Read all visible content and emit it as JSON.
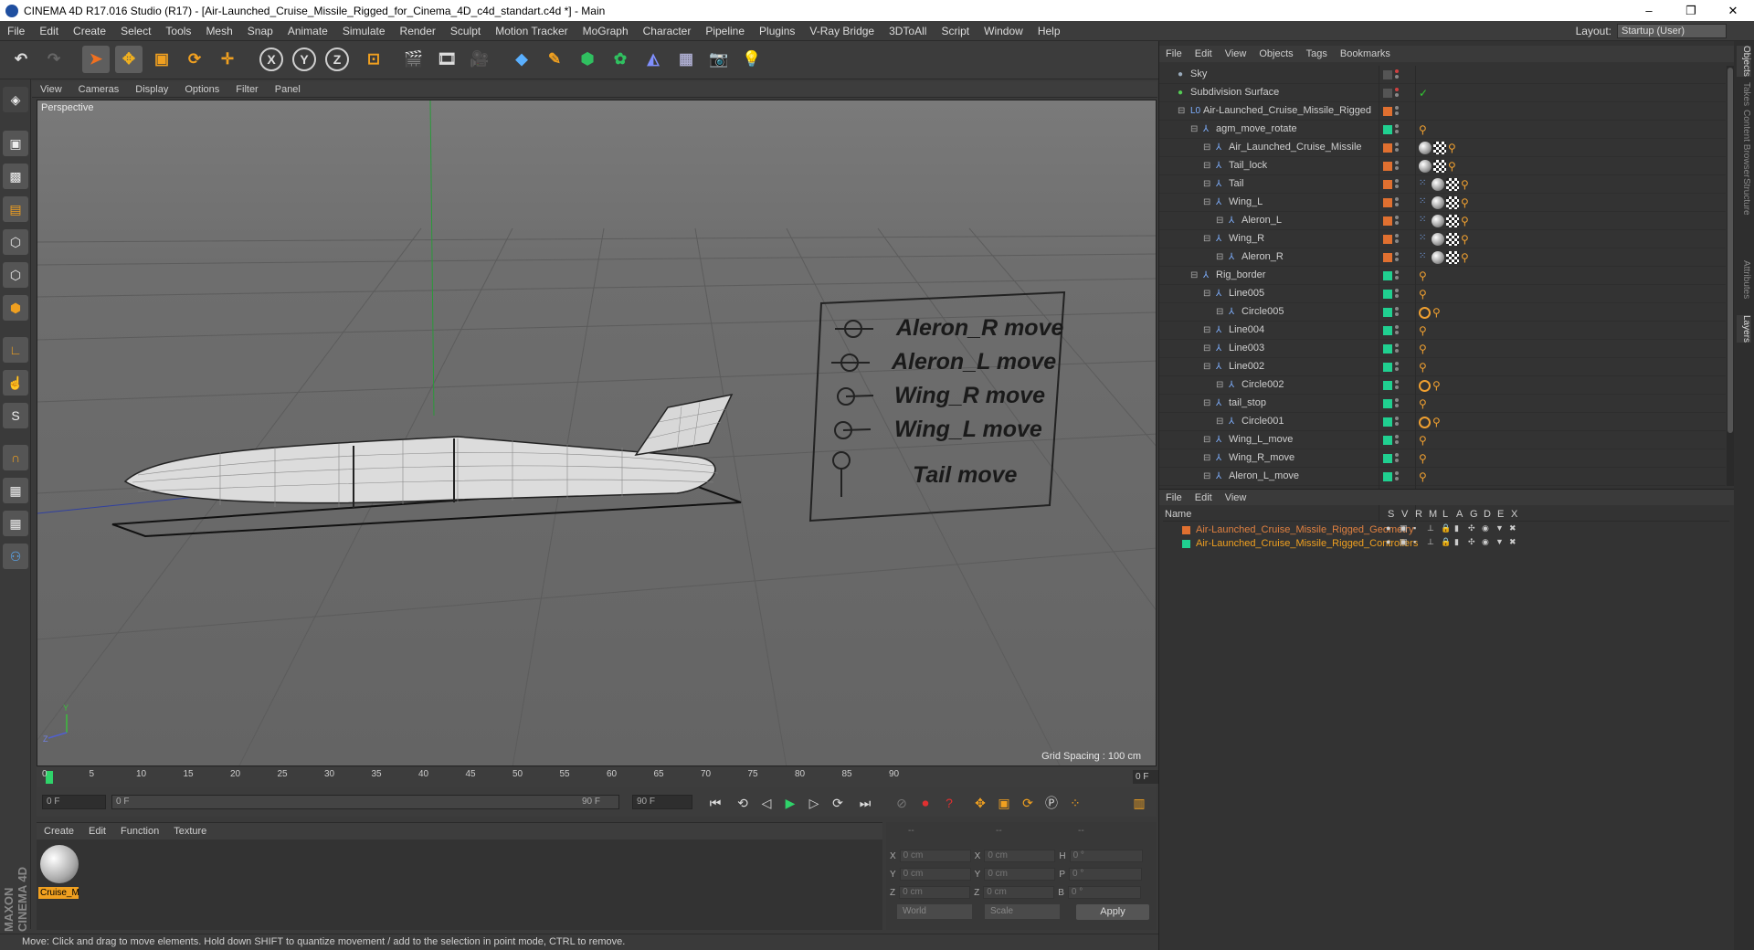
{
  "window": {
    "title": "CINEMA 4D R17.016 Studio (R17) - [Air-Launched_Cruise_Missile_Rigged_for_Cinema_4D_c4d_standart.c4d *] - Main",
    "minimize": "–",
    "maximize": "❐",
    "close": "✕"
  },
  "menu": [
    "File",
    "Edit",
    "Create",
    "Select",
    "Tools",
    "Mesh",
    "Snap",
    "Animate",
    "Simulate",
    "Render",
    "Sculpt",
    "Motion Tracker",
    "MoGraph",
    "Character",
    "Pipeline",
    "Plugins",
    "V-Ray Bridge",
    "3DToAll",
    "Script",
    "Window",
    "Help"
  ],
  "layout": {
    "label": "Layout:",
    "value": "Startup (User)"
  },
  "toolbar": {
    "x": "X",
    "y": "Y",
    "z": "Z"
  },
  "viewport": {
    "menu": [
      "View",
      "Cameras",
      "Display",
      "Options",
      "Filter",
      "Panel"
    ],
    "label": "Perspective",
    "grid_spacing": "Grid Spacing : 100 cm",
    "controls": [
      "Aleron_R move",
      "Aleron_L move",
      "Wing_R move",
      "Wing_L move",
      "Tail move"
    ],
    "axis_y": "Y",
    "axis_z": "Z"
  },
  "timeline": {
    "ticks": [
      "0",
      "5",
      "10",
      "15",
      "20",
      "25",
      "30",
      "35",
      "40",
      "45",
      "50",
      "55",
      "60",
      "65",
      "70",
      "75",
      "80",
      "85",
      "90"
    ],
    "current_frame": "0 F",
    "start": "0 F",
    "slider_start": "0 F",
    "slider_end": "90 F",
    "end": "90 F"
  },
  "material_panel": {
    "menu": [
      "Create",
      "Edit",
      "Function",
      "Texture"
    ],
    "material_name": "Cruise_M"
  },
  "coords": {
    "headers": [
      "--",
      "--",
      "--"
    ],
    "rows": [
      {
        "a": "X",
        "av": "0 cm",
        "b": "X",
        "bv": "0 cm",
        "c": "H",
        "cv": "0 °"
      },
      {
        "a": "Y",
        "av": "0 cm",
        "b": "Y",
        "bv": "0 cm",
        "c": "P",
        "cv": "0 °"
      },
      {
        "a": "Z",
        "av": "0 cm",
        "b": "Z",
        "bv": "0 cm",
        "c": "B",
        "cv": "0 °"
      }
    ],
    "world": "World",
    "scale": "Scale",
    "apply": "Apply"
  },
  "status": "Move: Click and drag to move elements. Hold down SHIFT to quantize movement / add to the selection in point mode, CTRL to remove.",
  "maxon": "MAXON CINEMA 4D",
  "objects_panel": {
    "menu": [
      "File",
      "Edit",
      "View",
      "Objects",
      "Tags",
      "Bookmarks"
    ],
    "items": [
      {
        "name": "Sky",
        "indent": 0,
        "layer": "",
        "tags": []
      },
      {
        "name": "Subdivision Surface",
        "indent": 0,
        "layer": "",
        "tags": []
      },
      {
        "name": "Air-Launched_Cruise_Missile_Rigged",
        "indent": 1,
        "layer": "#e07030",
        "tags": []
      },
      {
        "name": "agm_move_rotate",
        "indent": 2,
        "layer": "#20d090",
        "tags": [
          "bone"
        ]
      },
      {
        "name": "Air_Launched_Cruise_Missile",
        "indent": 3,
        "layer": "#e07030",
        "tags": [
          "sph",
          "chk",
          "bone"
        ]
      },
      {
        "name": "Tail_lock",
        "indent": 3,
        "layer": "#e07030",
        "tags": [
          "sph",
          "chk",
          "bone"
        ]
      },
      {
        "name": "Tail",
        "indent": 3,
        "layer": "#e07030",
        "tags": [
          "pts",
          "sph",
          "chk",
          "bone"
        ]
      },
      {
        "name": "Wing_L",
        "indent": 3,
        "layer": "#e07030",
        "tags": [
          "pts",
          "sph",
          "chk",
          "bone"
        ]
      },
      {
        "name": "Aleron_L",
        "indent": 4,
        "layer": "#e07030",
        "tags": [
          "pts",
          "sph",
          "chk",
          "bone"
        ]
      },
      {
        "name": "Wing_R",
        "indent": 3,
        "layer": "#e07030",
        "tags": [
          "pts",
          "sph",
          "chk",
          "bone"
        ]
      },
      {
        "name": "Aleron_R",
        "indent": 4,
        "layer": "#e07030",
        "tags": [
          "pts",
          "sph",
          "chk",
          "bone"
        ]
      },
      {
        "name": "Rig_border",
        "indent": 2,
        "layer": "#20d090",
        "tags": [
          "bone"
        ]
      },
      {
        "name": "Line005",
        "indent": 3,
        "layer": "#20d090",
        "tags": [
          "bone"
        ]
      },
      {
        "name": "Circle005",
        "indent": 4,
        "layer": "#20d090",
        "tags": [
          "no",
          "bone"
        ]
      },
      {
        "name": "Line004",
        "indent": 3,
        "layer": "#20d090",
        "tags": [
          "bone"
        ]
      },
      {
        "name": "Line003",
        "indent": 3,
        "layer": "#20d090",
        "tags": [
          "bone"
        ]
      },
      {
        "name": "Line002",
        "indent": 3,
        "layer": "#20d090",
        "tags": [
          "bone"
        ]
      },
      {
        "name": "Circle002",
        "indent": 4,
        "layer": "#20d090",
        "tags": [
          "no",
          "bone"
        ]
      },
      {
        "name": "tail_stop",
        "indent": 3,
        "layer": "#20d090",
        "tags": [
          "bone"
        ]
      },
      {
        "name": "Circle001",
        "indent": 4,
        "layer": "#20d090",
        "tags": [
          "no",
          "bone"
        ]
      },
      {
        "name": "Wing_L_move",
        "indent": 3,
        "layer": "#20d090",
        "tags": [
          "bone"
        ]
      },
      {
        "name": "Wing_R_move",
        "indent": 3,
        "layer": "#20d090",
        "tags": [
          "bone"
        ]
      },
      {
        "name": "Aleron_L_move",
        "indent": 3,
        "layer": "#20d090",
        "tags": [
          "bone"
        ]
      }
    ]
  },
  "layers_panel": {
    "menu": [
      "File",
      "Edit",
      "View"
    ],
    "header_name": "Name",
    "header_cols": [
      "S",
      "V",
      "R",
      "M",
      "L",
      "A",
      "G",
      "D",
      "E",
      "X"
    ],
    "layers": [
      {
        "name": "Air-Launched_Cruise_Missile_Rigged_Geometry",
        "color": "#e07030",
        "text": "#e08040"
      },
      {
        "name": "Air-Launched_Cruise_Missile_Rigged_Controllers",
        "color": "#20d090",
        "text": "#f0a020"
      }
    ]
  },
  "right_tabs": [
    "Objects",
    "Takes",
    "Content Browser",
    "Structure",
    "Attributes",
    "Layers"
  ]
}
